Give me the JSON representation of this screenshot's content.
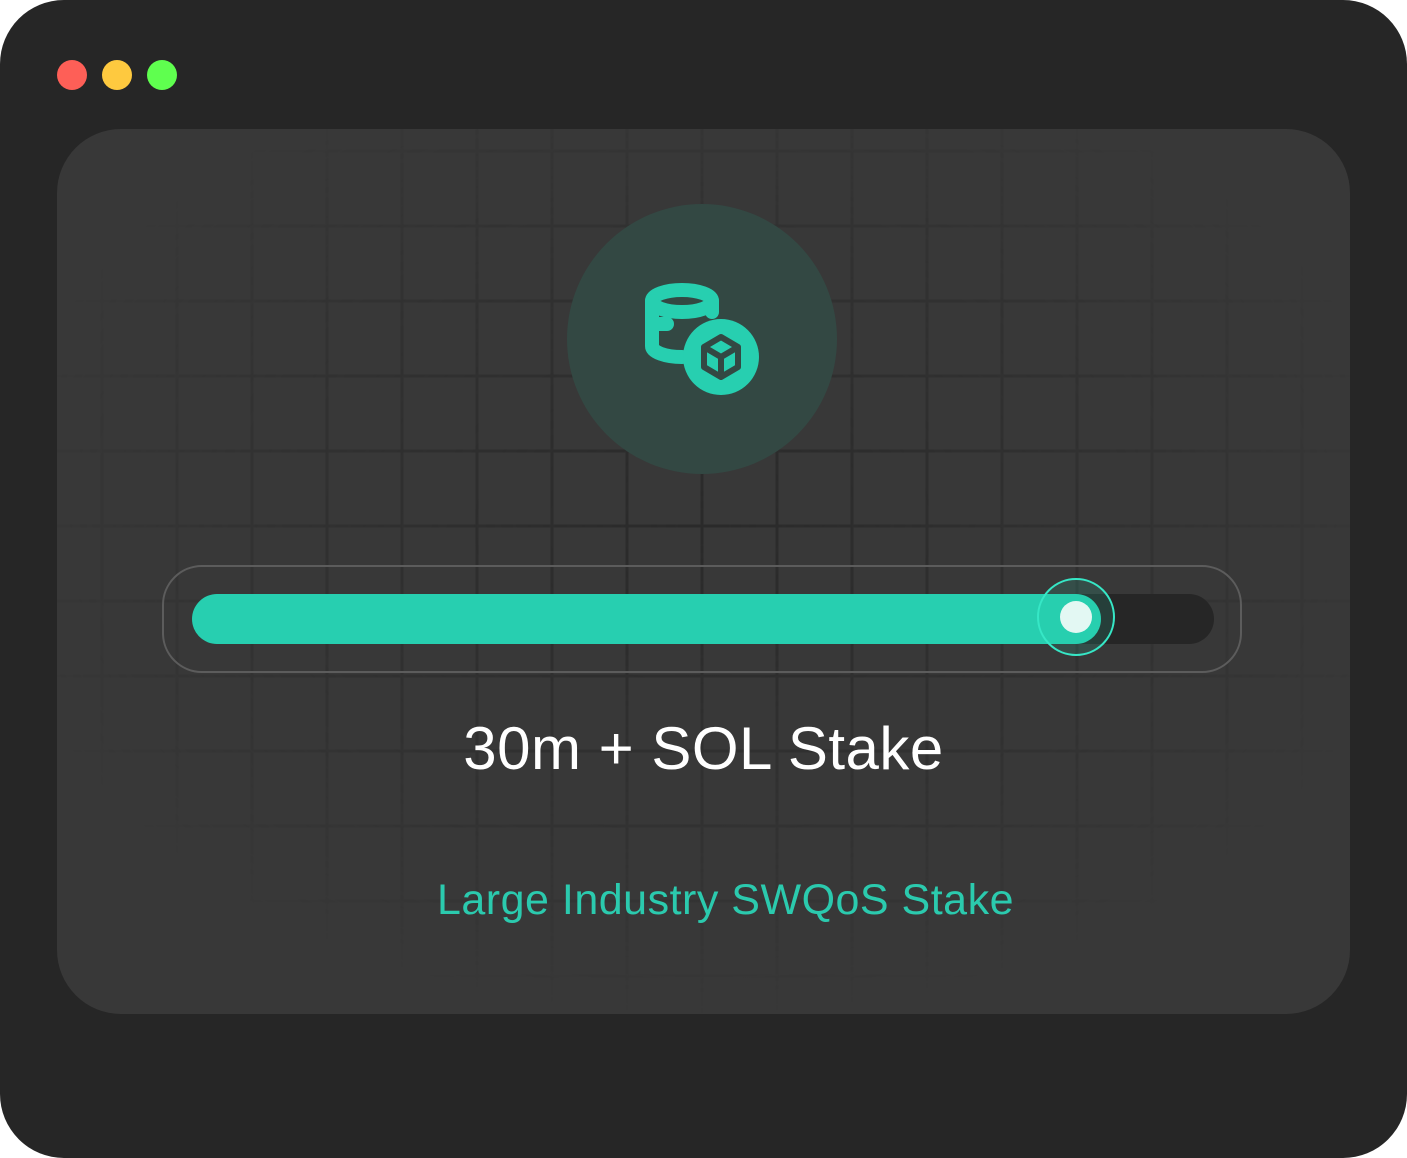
{
  "window": {
    "controls": [
      "close",
      "minimize",
      "maximize"
    ]
  },
  "icon": {
    "name": "staked-coins-icon",
    "accent": "#27cfb0",
    "background": "#334843"
  },
  "slider": {
    "value_fraction": 0.865,
    "fill_color": "#27cfb0",
    "track_color": "#262626"
  },
  "stake": {
    "label": "30m + SOL Stake",
    "description": "Large Industry SWQoS Stake"
  }
}
